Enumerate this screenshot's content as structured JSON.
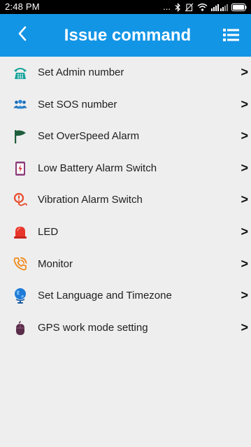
{
  "status_bar": {
    "time": "2:48 PM",
    "overflow": "...",
    "icons": [
      "bluetooth-icon",
      "no-sim-icon",
      "wifi-icon",
      "signal-icon",
      "battery-icon"
    ]
  },
  "header": {
    "title": "Issue command",
    "back_icon": "chevron-left-icon",
    "menu_icon": "list-menu-icon",
    "background": "#1395e6"
  },
  "commands": [
    {
      "label": "Set Admin number",
      "icon": "phone-keypad-icon",
      "chevron": ">"
    },
    {
      "label": "Set SOS number",
      "icon": "people-group-icon",
      "chevron": ">"
    },
    {
      "label": "Set OverSpeed Alarm",
      "icon": "flag-icon",
      "chevron": ">"
    },
    {
      "label": "Low Battery Alarm Switch",
      "icon": "low-battery-icon",
      "chevron": ">"
    },
    {
      "label": "Vibration Alarm Switch",
      "icon": "vibration-pin-icon",
      "chevron": ">"
    },
    {
      "label": "LED",
      "icon": "red-light-icon",
      "chevron": ">"
    },
    {
      "label": "Monitor",
      "icon": "phone-ringing-icon",
      "chevron": ">"
    },
    {
      "label": "Set Language and Timezone",
      "icon": "globe-icon",
      "chevron": ">"
    },
    {
      "label": "GPS work mode setting",
      "icon": "mouse-icon",
      "chevron": ">"
    }
  ],
  "colors": {
    "accent": "#1395e6",
    "list_background": "#eeeeee",
    "text": "#1e1e1e"
  }
}
